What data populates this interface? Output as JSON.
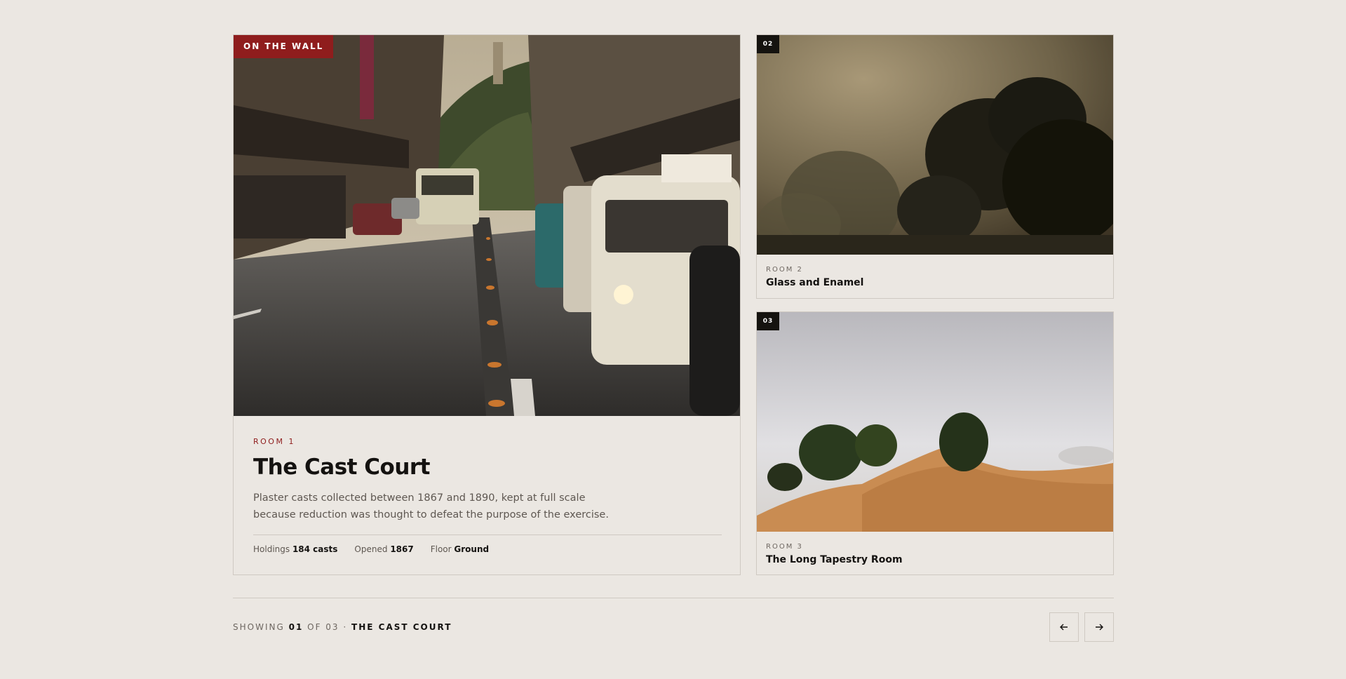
{
  "featured": {
    "tag": "ON THE WALL",
    "eyebrow": "ROOM 1",
    "title": "The Cast Court",
    "description": "Plaster casts collected between 1867 and 1890, kept at full scale because reduction was thought to defeat the purpose of the exercise.",
    "stats": [
      {
        "label": "Holdings",
        "value": "184 casts"
      },
      {
        "label": "Opened",
        "value": "1867"
      },
      {
        "label": "Floor",
        "value": "Ground"
      }
    ]
  },
  "side_cards": [
    {
      "number": "02",
      "eyebrow": "ROOM 2",
      "title": "Glass and Enamel"
    },
    {
      "number": "03",
      "eyebrow": "ROOM 3",
      "title": "The Long Tapestry Room"
    }
  ],
  "pager": {
    "prefix": "SHOWING",
    "current": "01",
    "of": "OF 03",
    "separator": "·",
    "current_title": "THE CAST COURT",
    "prev_icon": "arrow-left-icon",
    "next_icon": "arrow-right-icon"
  },
  "colors": {
    "background": "#ebe7e2",
    "accent_red": "#8f1d1d",
    "ink": "#141210"
  }
}
